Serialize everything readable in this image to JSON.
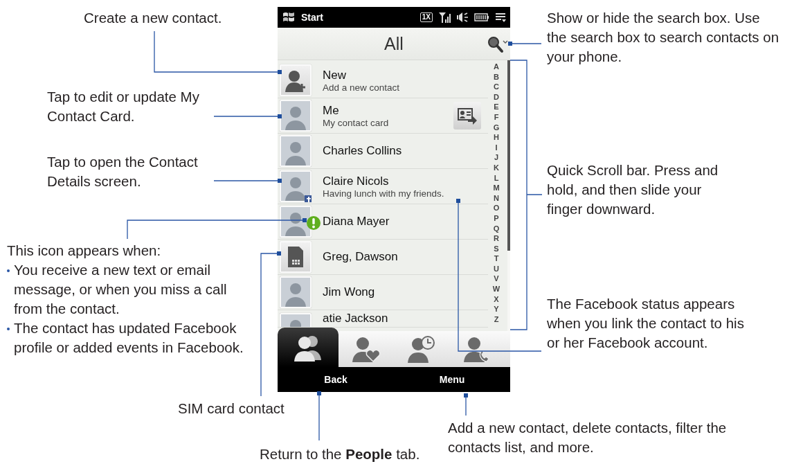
{
  "phone": {
    "status_bar": {
      "title": "Start",
      "network": "1X"
    },
    "header": {
      "title": "All"
    },
    "contacts": [
      {
        "name": "New",
        "subtitle": "Add a new contact",
        "kind": "add",
        "facebook": false,
        "alert": false
      },
      {
        "name": "Me",
        "subtitle": "My contact card",
        "kind": "me",
        "facebook": false,
        "alert": false
      },
      {
        "name": "Charles Collins",
        "kind": "photo",
        "facebook": false,
        "alert": false
      },
      {
        "name": "Claire Nicols",
        "subtitle": "Having lunch with my friends.",
        "kind": "photo",
        "facebook": true,
        "alert": false
      },
      {
        "name": "Diana Mayer",
        "kind": "photo",
        "facebook": false,
        "alert": true
      },
      {
        "name": "Greg, Dawson",
        "kind": "sim",
        "facebook": false,
        "alert": false
      },
      {
        "name": "Jim Wong",
        "kind": "photo",
        "facebook": false,
        "alert": false
      },
      {
        "name": "atie Jackson",
        "kind": "photo",
        "facebook": false,
        "alert": false
      }
    ],
    "quick_scroll": [
      "A",
      "B",
      "C",
      "D",
      "E",
      "F",
      "G",
      "H",
      "I",
      "J",
      "K",
      "L",
      "M",
      "N",
      "O",
      "P",
      "Q",
      "R",
      "S",
      "T",
      "U",
      "V",
      "W",
      "X",
      "Y",
      "Z"
    ],
    "tabs": [
      {
        "kind": "people",
        "selected": true
      },
      {
        "kind": "favorites",
        "selected": false
      },
      {
        "kind": "history",
        "selected": false
      },
      {
        "kind": "calls",
        "selected": false
      }
    ],
    "softkeys": [
      "Back",
      "Menu"
    ]
  },
  "callouts": [
    {
      "kind": "create",
      "text": "Create a new contact."
    },
    {
      "kind": "search",
      "text": "Show or hide the search box. Use the search box to search contacts on your phone."
    },
    {
      "kind": "card",
      "text": "Tap to edit or update My Contact Card."
    },
    {
      "kind": "details",
      "text": "Tap to open the Contact Details screen."
    },
    {
      "kind": "scroll",
      "text": "Quick Scroll bar. Press and hold, and then slide your finger downward."
    },
    {
      "kind": "alert",
      "text": "This icon appears when:",
      "bullets": [
        "You receive a new text or email message, or when you miss a call from the contact.",
        "The contact has updated Facebook profile or added events in Facebook."
      ]
    },
    {
      "kind": "facebook",
      "text": "The Facebook status appears when you link the contact to his or her Facebook account."
    },
    {
      "kind": "sim",
      "text": "SIM card contact"
    },
    {
      "kind": "menu",
      "text": "Add a new contact, delete contacts, filter the contacts list, and more."
    },
    {
      "kind": "back",
      "text": "Return to the **People** tab."
    }
  ]
}
